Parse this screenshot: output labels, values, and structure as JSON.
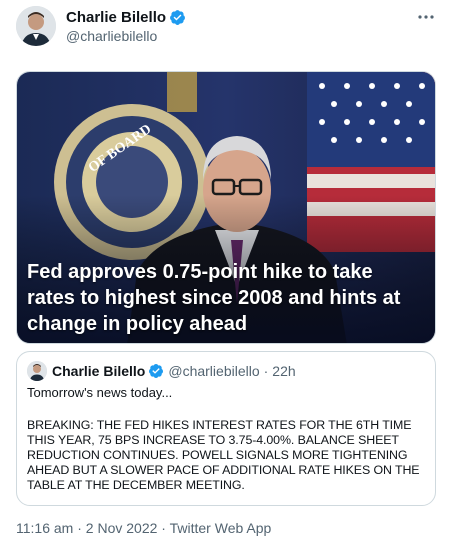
{
  "author": {
    "display_name": "Charlie Bilello",
    "handle": "@charliebilello",
    "avatar_icon": "profile-photo"
  },
  "media": {
    "headline": "Fed approves 0.75-point hike to take rates to highest since 2008 and hints at change in policy ahead",
    "seal_text": "OF BOARD"
  },
  "quoted_tweet": {
    "display_name": "Charlie Bilello",
    "handle": "@charliebilello",
    "separator": "·",
    "time": "22h",
    "intro": "Tomorrow's news today...",
    "body": "BREAKING: THE FED HIKES INTEREST RATES FOR THE 6TH TIME\nTHIS YEAR, 75 BPS INCREASE TO 3.75-4.00%. BALANCE SHEET\nREDUCTION CONTINUES. POWELL SIGNALS MORE TIGHTENING\nAHEAD BUT A SLOWER PACE OF ADDITIONAL RATE HIKES ON THE\nTABLE AT THE DECEMBER MEETING."
  },
  "meta": {
    "time": "11:16 am",
    "date": "2 Nov 2022",
    "source": "Twitter Web App",
    "separator": " · "
  },
  "colors": {
    "verified": "#1d9bf0",
    "secondary_text": "#536471",
    "border": "#cfd9de"
  }
}
